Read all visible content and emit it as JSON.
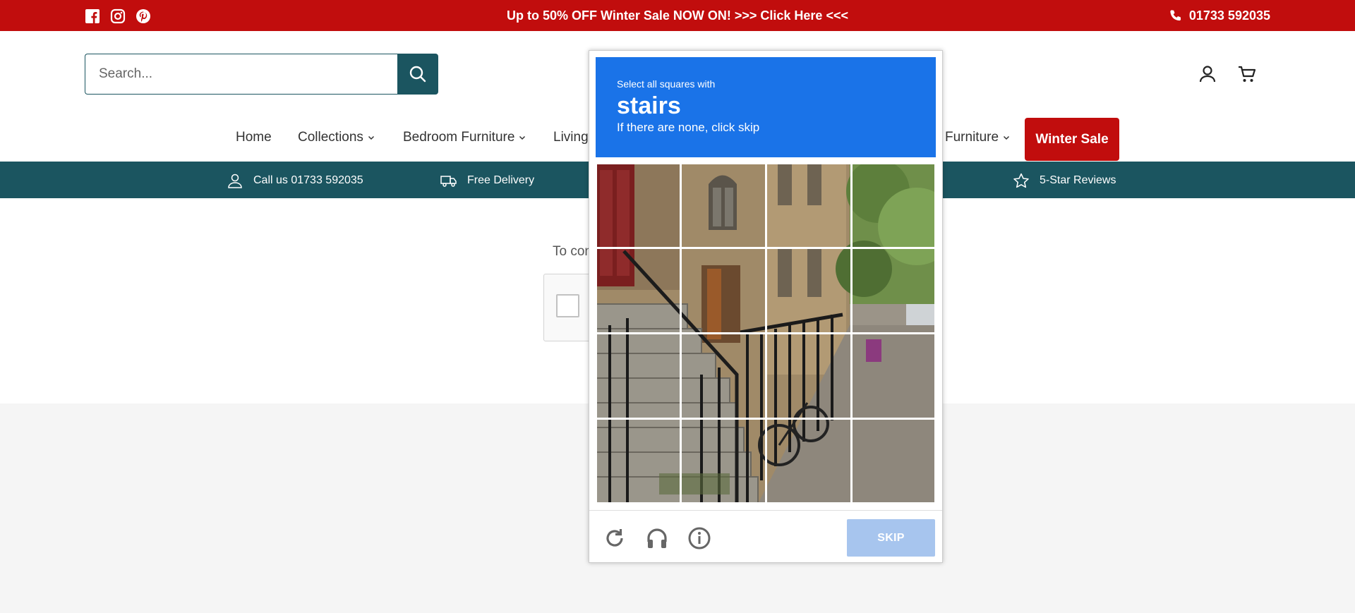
{
  "announcement": {
    "promo_text": "Up to 50% OFF Winter Sale NOW ON! >>> Click Here <<<",
    "phone": "01733 592035",
    "social_icons": [
      "facebook-icon",
      "instagram-icon",
      "pinterest-icon"
    ]
  },
  "header": {
    "search_placeholder": "Search...",
    "icons": [
      "account-icon",
      "cart-icon"
    ]
  },
  "nav": {
    "items": [
      {
        "label": "Home",
        "has_dropdown": false
      },
      {
        "label": "Collections",
        "has_dropdown": true
      },
      {
        "label": "Bedroom Furniture",
        "has_dropdown": true
      },
      {
        "label": "Living",
        "has_dropdown": false
      },
      {
        "label": "Furniture",
        "has_dropdown": true
      }
    ],
    "sale_label": "Winter Sale"
  },
  "usp": {
    "items": [
      "Call us 01733 592035",
      "Free Delivery",
      "5-Star Reviews"
    ]
  },
  "body": {
    "text": "To con"
  },
  "captcha": {
    "instruction_line1": "Select all squares with",
    "target": "stairs",
    "instruction_line3": "If there are none, click skip",
    "skip_label": "SKIP",
    "grid_rows": 4,
    "grid_cols": 4,
    "footer_icons": [
      "reload-icon",
      "audio-icon",
      "info-icon"
    ]
  },
  "colors": {
    "brand_red": "#c10d0d",
    "brand_teal": "#1b5560",
    "captcha_blue": "#1a73e8",
    "skip_disabled": "#a7c5ee"
  }
}
